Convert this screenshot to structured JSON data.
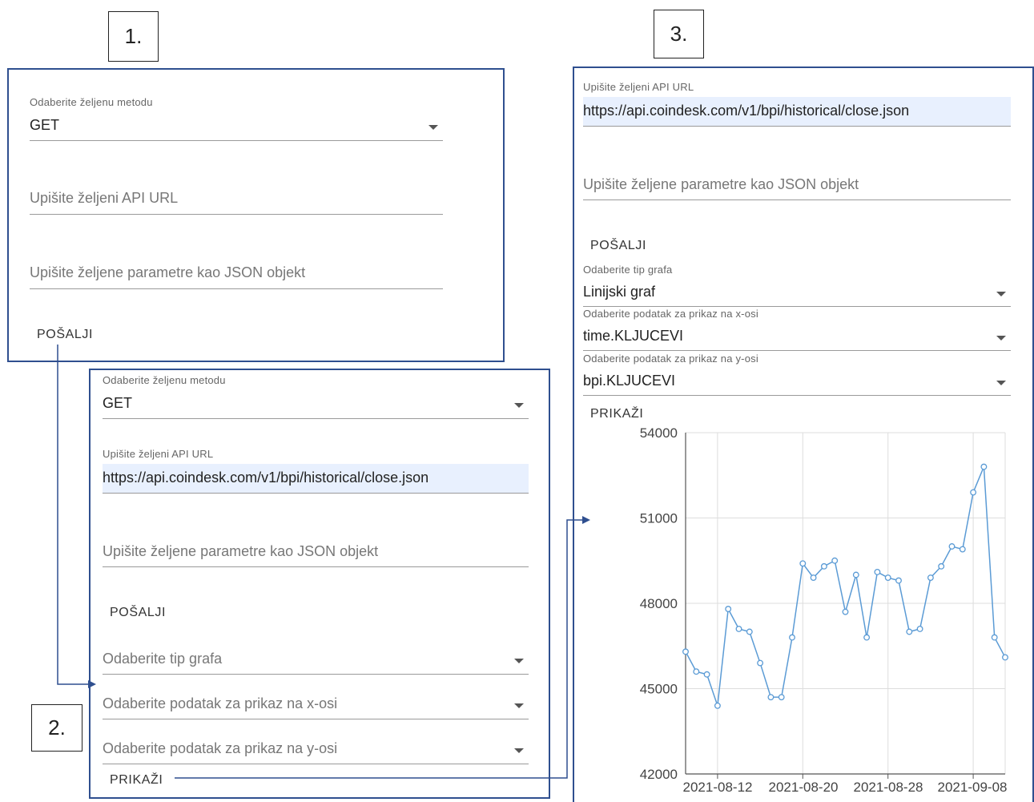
{
  "steps": {
    "one": "1.",
    "two": "2.",
    "three": "3."
  },
  "panel1": {
    "method_label": "Odaberite željenu metodu",
    "method_value": "GET",
    "url_placeholder": "Upišite željeni API URL",
    "params_placeholder": "Upišite željene parametre kao JSON objekt",
    "send_button": "POŠALJI"
  },
  "panel2": {
    "method_label": "Odaberite željenu metodu",
    "method_value": "GET",
    "url_label": "Upišite željeni API URL",
    "url_value": "https://api.coindesk.com/v1/bpi/historical/close.json",
    "params_placeholder": "Upišite željene parametre kao JSON objekt",
    "send_button": "POŠALJI",
    "chart_type_placeholder": "Odaberite tip grafa",
    "x_placeholder": "Odaberite podatak za prikaz na x-osi",
    "y_placeholder": "Odaberite podatak za prikaz na y-osi",
    "show_button": "PRIKAŽI"
  },
  "panel3": {
    "url_label": "Upišite željeni API URL",
    "url_value": "https://api.coindesk.com/v1/bpi/historical/close.json",
    "params_placeholder": "Upišite željene parametre kao JSON objekt",
    "send_button": "POŠALJI",
    "chart_type_label": "Odaberite tip grafa",
    "chart_type_value": "Linijski graf",
    "x_label": "Odaberite podatak za prikaz na x-osi",
    "x_value": "time.KLJUCEVI",
    "y_label": "Odaberite podatak za prikaz na y-osi",
    "y_value": "bpi.KLJUCEVI",
    "show_button": "PRIKAŽI"
  },
  "colors": {
    "panel_border": "#2f4f8f",
    "line": "#5b9bd5",
    "highlight": "#e8f0fe"
  },
  "chart_data": {
    "type": "line",
    "ylim": [
      42000,
      54000
    ],
    "yticks": [
      54000,
      51000,
      48000,
      45000,
      42000
    ],
    "xticks": [
      "2021-08-12",
      "2021-08-20",
      "2021-08-28",
      "2021-09-08"
    ],
    "grid": true,
    "values": [
      46300,
      45600,
      45500,
      44400,
      47800,
      47100,
      47000,
      45900,
      44700,
      44700,
      46800,
      49400,
      48900,
      49300,
      49500,
      47700,
      49000,
      46800,
      49100,
      48900,
      48800,
      47000,
      47100,
      48900,
      49300,
      50000,
      49900,
      51900,
      52800,
      46800,
      46100
    ]
  }
}
